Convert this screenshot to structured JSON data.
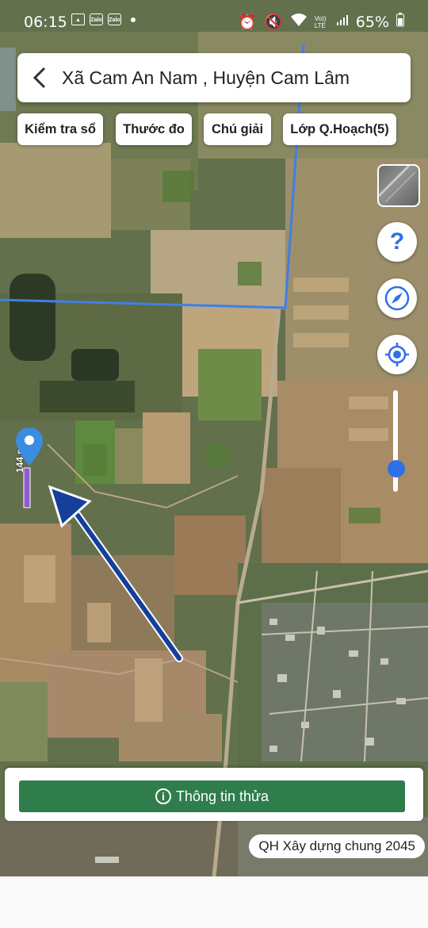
{
  "status_bar": {
    "time": "06:15",
    "app_icons": [
      "image-icon",
      "zalo-icon",
      "zalo-icon"
    ],
    "zalo_label": "Zalo",
    "network_label": "Vo)) LTE",
    "battery": "65%"
  },
  "header": {
    "title": "Xã Cam An Nam , Huyện Cam Lâm"
  },
  "toolbar": {
    "chips": [
      "Kiểm tra sổ",
      "Thước đo",
      "Chú giải",
      "Lớp Q.Hoạch(5)"
    ]
  },
  "map": {
    "measure_label": "144 m",
    "marker_icon": "location-pin-icon",
    "zoom_level": 0.15
  },
  "side_controls": {
    "help_label": "?",
    "icons": [
      "layers-icon",
      "help-icon",
      "compass-icon",
      "my-location-icon"
    ]
  },
  "bottom": {
    "info_button": "Thông tin thửa",
    "info_icon_label": "i",
    "planning_badge": "QH Xây dựng chung 2045"
  },
  "colors": {
    "accent_green": "#2e7d4a",
    "accent_blue": "#2f6fe8",
    "boundary_blue": "#3f7fe8",
    "arrow_blue": "#163f9c"
  }
}
